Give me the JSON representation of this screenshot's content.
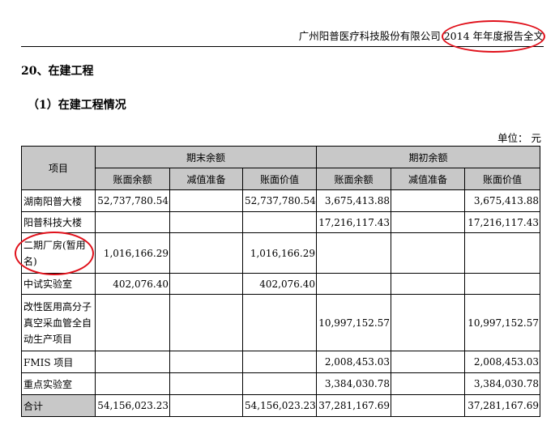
{
  "header": {
    "title": "广州阳普医疗科技股份有限公司 2014 年年度报告全文"
  },
  "section": {
    "title": "20、在建工程"
  },
  "subsection": {
    "title": "（1）在建工程情况"
  },
  "unit": {
    "label": "单位：  元"
  },
  "table": {
    "item_header": "项目",
    "group_end": "期末余额",
    "group_begin": "期初余额",
    "subheaders": [
      "账面余额",
      "减值准备",
      "账面价值",
      "账面余额",
      "减值准备",
      "账面价值"
    ],
    "rows": [
      {
        "name": "湖南阳普大楼",
        "cells": [
          "52,737,780.54",
          "",
          "52,737,780.54",
          "3,675,413.88",
          "",
          "3,675,413.88"
        ]
      },
      {
        "name": "阳普科技大楼",
        "cells": [
          "",
          "",
          "",
          "17,216,117.43",
          "",
          "17,216,117.43"
        ]
      },
      {
        "name": "二期厂房(暂用名)",
        "cells": [
          "1,016,166.29",
          "",
          "1,016,166.29",
          "",
          "",
          ""
        ]
      },
      {
        "name": "中试实验室",
        "cells": [
          "402,076.40",
          "",
          "402,076.40",
          "",
          "",
          ""
        ]
      },
      {
        "name": "改性医用高分子真空采血管全自动生产项目",
        "cells": [
          "",
          "",
          "",
          "10,997,152.57",
          "",
          "10,997,152.57"
        ]
      },
      {
        "name": "FMIS 项目",
        "cells": [
          "",
          "",
          "",
          "2,008,453.03",
          "",
          "2,008,453.03"
        ]
      },
      {
        "name": "重点实验室",
        "cells": [
          "",
          "",
          "",
          "3,384,030.78",
          "",
          "3,384,030.78"
        ]
      }
    ],
    "total": {
      "name": "合计",
      "cells": [
        "54,156,023.23",
        "",
        "54,156,023.23",
        "37,281,167.69",
        "",
        "37,281,167.69"
      ]
    }
  },
  "annotation_color": "#e0101a"
}
